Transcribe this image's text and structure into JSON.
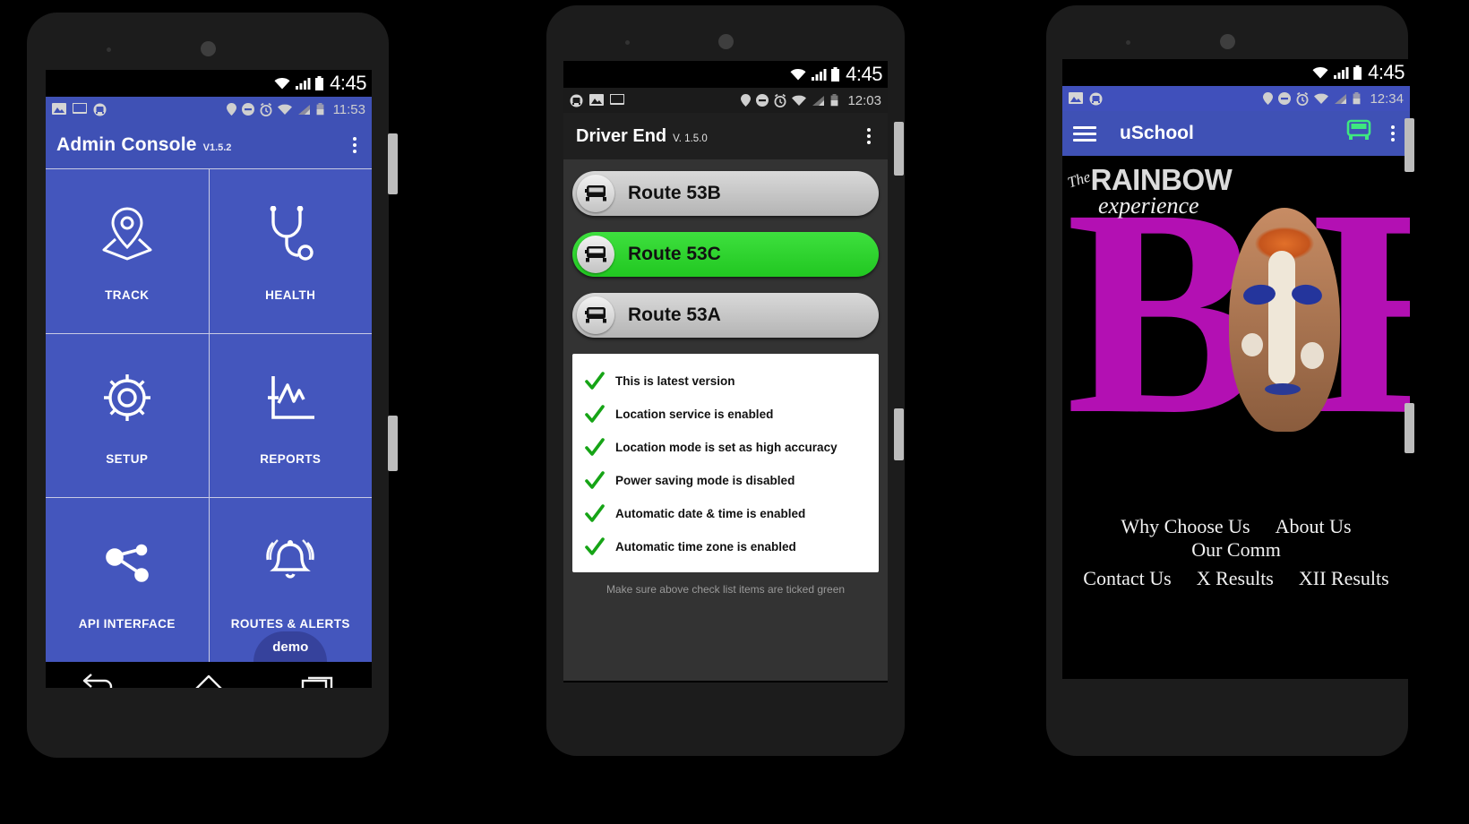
{
  "phones": [
    {
      "id": "admin-console",
      "status_bar": {
        "clock": "4:45",
        "icons": [
          "wifi-icon",
          "signal-icon",
          "battery-icon"
        ]
      },
      "notification_bar": {
        "time": "11:53",
        "left_icons": [
          "image-icon",
          "cast-icon",
          "bus-app-icon"
        ],
        "right_icons": [
          "location-icon",
          "do-not-disturb-icon",
          "alarm-icon",
          "wifi-icon",
          "signal-icon",
          "battery-icon"
        ]
      },
      "appbar": {
        "title": "Admin Console",
        "version": "V1.5.2",
        "overflow": "more-options"
      },
      "tiles": [
        {
          "label": "TRACK",
          "icon": "map-pin-icon"
        },
        {
          "label": "HEALTH",
          "icon": "stethoscope-icon"
        },
        {
          "label": "SETUP",
          "icon": "gear-icon"
        },
        {
          "label": "REPORTS",
          "icon": "chart-icon"
        },
        {
          "label": "API INTERFACE",
          "icon": "share-nodes-icon"
        },
        {
          "label": "ROUTES & ALERTS",
          "icon": "bell-ring-icon"
        }
      ],
      "demo_badge": "demo",
      "nav": [
        "back-button",
        "home-button",
        "recents-button"
      ]
    },
    {
      "id": "driver-end",
      "status_bar": {
        "clock": "4:45",
        "icons": [
          "wifi-icon",
          "signal-icon",
          "battery-icon"
        ]
      },
      "notification_bar": {
        "time": "12:03",
        "left_icons": [
          "bus-app-icon",
          "image-icon",
          "cast-icon"
        ],
        "right_icons": [
          "location-icon",
          "do-not-disturb-icon",
          "alarm-icon",
          "wifi-icon",
          "signal-icon",
          "battery-icon"
        ]
      },
      "appbar": {
        "title": "Driver End",
        "version": "V. 1.5.0",
        "overflow": "more-options"
      },
      "routes": [
        {
          "label": "Route  53B",
          "state": "inactive",
          "icon": "bus-icon"
        },
        {
          "label": "Route 53C",
          "state": "active",
          "icon": "bus-icon"
        },
        {
          "label": "Route 53A",
          "state": "inactive",
          "icon": "bus-icon"
        }
      ],
      "checklist": [
        "This is latest version",
        "Location service is enabled",
        "Location mode is set as high accuracy",
        "Power saving mode is disabled",
        "Automatic date & time is enabled",
        "Automatic time zone is enabled"
      ],
      "note": "Make sure above check list items are ticked green",
      "nav": [
        "back-button",
        "home-button",
        "recents-button"
      ]
    },
    {
      "id": "uschool",
      "status_bar": {
        "clock": "4:45",
        "icons": [
          "wifi-icon",
          "signal-icon",
          "battery-icon"
        ]
      },
      "notification_bar": {
        "time": "12:34",
        "left_icons": [
          "image-icon",
          "bus-app-icon"
        ],
        "right_icons": [
          "location-icon",
          "do-not-disturb-icon",
          "alarm-icon",
          "wifi-icon",
          "signal-icon",
          "battery-icon"
        ]
      },
      "appbar": {
        "menu": "menu-icon",
        "title": "uSchool",
        "bus": "bus-icon",
        "overflow": "more-options"
      },
      "cover": {
        "brand_the": "The",
        "brand_main": "RAINBOW",
        "brand_sub": "experience",
        "big_letters": "B"
      },
      "links_row1": [
        "Why Choose Us",
        "About Us",
        "Our Comm"
      ],
      "links_row2": [
        "Contact Us",
        "X Results",
        "XII Results"
      ],
      "nav": [
        "back-button",
        "home-button",
        "recents-button"
      ]
    }
  ],
  "colors": {
    "primary_blue": "#3f51b5",
    "tile_blue": "#4456bd",
    "demo_badge_blue": "#36429c",
    "active_green": "#2ecc2e",
    "check_green": "#1eaa1e",
    "inactive_grey": "#c6c6c6",
    "dark_bg": "#333333",
    "magenta": "#b310b3"
  }
}
